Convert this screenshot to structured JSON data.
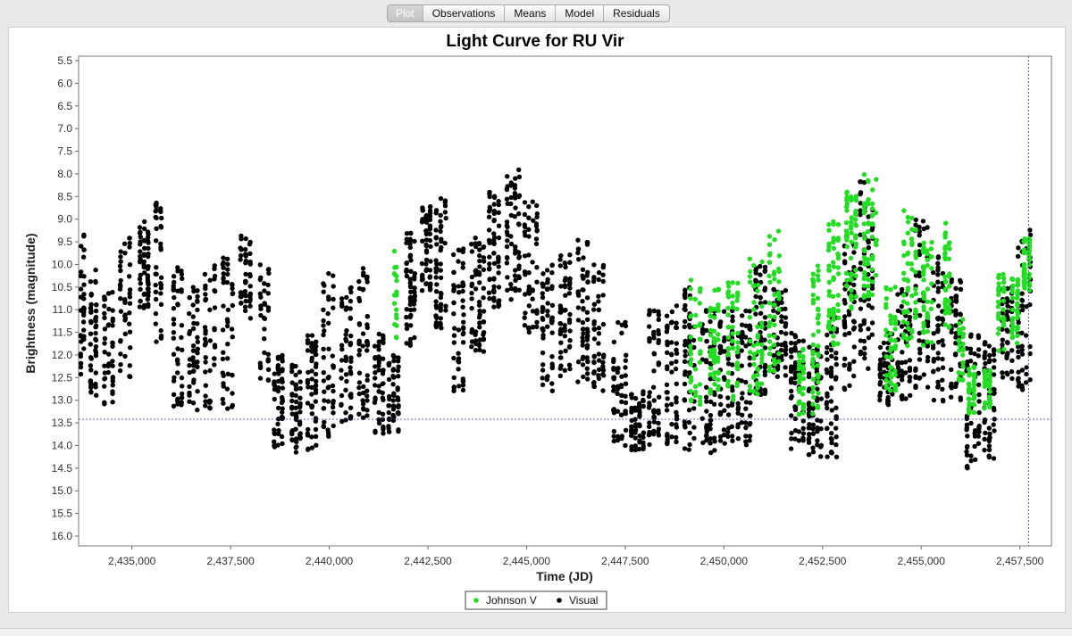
{
  "tabs": [
    {
      "label": "Plot",
      "active": true
    },
    {
      "label": "Observations",
      "active": false
    },
    {
      "label": "Means",
      "active": false
    },
    {
      "label": "Model",
      "active": false
    },
    {
      "label": "Residuals",
      "active": false
    }
  ],
  "colors": {
    "johnson_v": "#22dd22",
    "visual": "#000000",
    "crosshair": "#3333aa"
  },
  "chart_data": {
    "type": "scatter",
    "title": "Light Curve for RU Vir",
    "xlabel": "Time (JD)",
    "ylabel": "Brightness (magnitude)",
    "xlim": [
      2433650,
      2458300
    ],
    "ylim": [
      5.5,
      16.2
    ],
    "y_inverted": true,
    "xticks": [
      2435000,
      2437500,
      2440000,
      2442500,
      2445000,
      2447500,
      2450000,
      2452500,
      2455000,
      2457500
    ],
    "xtick_labels": [
      "2,435,000",
      "2,437,500",
      "2,440,000",
      "2,442,500",
      "2,445,000",
      "2,447,500",
      "2,450,000",
      "2,452,500",
      "2,455,000",
      "2,457,500"
    ],
    "yticks": [
      5.5,
      6.0,
      6.5,
      7.0,
      7.5,
      8.0,
      8.5,
      9.0,
      9.5,
      10.0,
      10.5,
      11.0,
      11.5,
      12.0,
      12.5,
      13.0,
      13.5,
      14.0,
      14.5,
      15.0,
      15.5,
      16.0
    ],
    "ytick_labels": [
      "5.5",
      "6.0",
      "6.5",
      "7.0",
      "7.5",
      "8.0",
      "8.5",
      "9.0",
      "9.5",
      "10.0",
      "10.5",
      "11.0",
      "11.5",
      "12.0",
      "12.5",
      "13.0",
      "13.5",
      "14.0",
      "14.5",
      "15.0",
      "15.5",
      "16.0"
    ],
    "crosshair": {
      "x": 2457720,
      "y": 13.42
    },
    "grid": false,
    "legend": {
      "placement": "bottom-center"
    },
    "series": [
      {
        "name": "Johnson V",
        "color": "#22dd22",
        "observing_windows": [
          {
            "x0": 2441650,
            "x1": 2441750,
            "ymin": 9.7,
            "ymax": 11.8,
            "n": 18
          },
          {
            "x0": 2449150,
            "x1": 2449500,
            "ymin": 10.3,
            "ymax": 13.1,
            "n": 40
          },
          {
            "x0": 2449650,
            "x1": 2449950,
            "ymin": 10.5,
            "ymax": 12.9,
            "n": 45
          },
          {
            "x0": 2450100,
            "x1": 2450450,
            "ymin": 10.4,
            "ymax": 13.0,
            "n": 45
          },
          {
            "x0": 2450650,
            "x1": 2451050,
            "ymin": 9.8,
            "ymax": 12.9,
            "n": 45
          },
          {
            "x0": 2451150,
            "x1": 2451500,
            "ymin": 9.2,
            "ymax": 12.4,
            "n": 45
          },
          {
            "x0": 2451900,
            "x1": 2452100,
            "ymin": 11.8,
            "ymax": 13.4,
            "n": 35
          },
          {
            "x0": 2452250,
            "x1": 2452500,
            "ymin": 10.0,
            "ymax": 13.3,
            "n": 45
          },
          {
            "x0": 2452650,
            "x1": 2453000,
            "ymin": 9.0,
            "ymax": 11.8,
            "n": 55
          },
          {
            "x0": 2453100,
            "x1": 2453450,
            "ymin": 8.3,
            "ymax": 11.0,
            "n": 60
          },
          {
            "x0": 2453550,
            "x1": 2453950,
            "ymin": 8.0,
            "ymax": 10.8,
            "n": 55
          },
          {
            "x0": 2454100,
            "x1": 2454450,
            "ymin": 10.5,
            "ymax": 12.8,
            "n": 50
          },
          {
            "x0": 2454550,
            "x1": 2454950,
            "ymin": 8.8,
            "ymax": 11.8,
            "n": 55
          },
          {
            "x0": 2455050,
            "x1": 2455350,
            "ymin": 9.5,
            "ymax": 11.9,
            "n": 45
          },
          {
            "x0": 2455600,
            "x1": 2455800,
            "ymin": 9.0,
            "ymax": 11.5,
            "n": 40
          },
          {
            "x0": 2455950,
            "x1": 2456150,
            "ymin": 11.2,
            "ymax": 12.6,
            "n": 30
          },
          {
            "x0": 2456200,
            "x1": 2456450,
            "ymin": 12.2,
            "ymax": 13.3,
            "n": 40
          },
          {
            "x0": 2456600,
            "x1": 2456850,
            "ymin": 12.3,
            "ymax": 13.2,
            "n": 30
          },
          {
            "x0": 2456950,
            "x1": 2457200,
            "ymin": 10.2,
            "ymax": 12.0,
            "n": 35
          },
          {
            "x0": 2457300,
            "x1": 2457550,
            "ymin": 10.3,
            "ymax": 11.8,
            "n": 40
          },
          {
            "x0": 2457600,
            "x1": 2457850,
            "ymin": 9.4,
            "ymax": 10.6,
            "n": 50
          }
        ]
      },
      {
        "name": "Visual",
        "color": "#000000",
        "observing_windows": [
          {
            "x0": 2433700,
            "x1": 2433850,
            "ymin": 9.3,
            "ymax": 12.7,
            "n": 35
          },
          {
            "x0": 2433950,
            "x1": 2434200,
            "ymin": 10.0,
            "ymax": 12.9,
            "n": 45
          },
          {
            "x0": 2434300,
            "x1": 2434600,
            "ymin": 10.5,
            "ymax": 13.1,
            "n": 45
          },
          {
            "x0": 2434700,
            "x1": 2435050,
            "ymin": 9.4,
            "ymax": 12.6,
            "n": 45
          },
          {
            "x0": 2435200,
            "x1": 2435500,
            "ymin": 8.9,
            "ymax": 11.0,
            "n": 60
          },
          {
            "x0": 2435600,
            "x1": 2435850,
            "ymin": 8.6,
            "ymax": 12.0,
            "n": 40
          },
          {
            "x0": 2436050,
            "x1": 2436350,
            "ymin": 10.0,
            "ymax": 13.2,
            "n": 45
          },
          {
            "x0": 2436450,
            "x1": 2436750,
            "ymin": 10.5,
            "ymax": 13.3,
            "n": 45
          },
          {
            "x0": 2436850,
            "x1": 2437200,
            "ymin": 10.0,
            "ymax": 13.3,
            "n": 45
          },
          {
            "x0": 2437300,
            "x1": 2437650,
            "ymin": 9.8,
            "ymax": 13.2,
            "n": 45
          },
          {
            "x0": 2437750,
            "x1": 2438100,
            "ymin": 9.3,
            "ymax": 11.2,
            "n": 45
          },
          {
            "x0": 2438250,
            "x1": 2438550,
            "ymin": 10.0,
            "ymax": 12.6,
            "n": 35
          },
          {
            "x0": 2438600,
            "x1": 2438900,
            "ymin": 12.0,
            "ymax": 14.1,
            "n": 50
          },
          {
            "x0": 2439050,
            "x1": 2439350,
            "ymin": 12.2,
            "ymax": 14.2,
            "n": 50
          },
          {
            "x0": 2439450,
            "x1": 2439750,
            "ymin": 11.5,
            "ymax": 14.1,
            "n": 50
          },
          {
            "x0": 2439850,
            "x1": 2440200,
            "ymin": 10.2,
            "ymax": 13.8,
            "n": 50
          },
          {
            "x0": 2440300,
            "x1": 2440650,
            "ymin": 10.5,
            "ymax": 13.5,
            "n": 50
          },
          {
            "x0": 2440750,
            "x1": 2441050,
            "ymin": 10.0,
            "ymax": 13.4,
            "n": 50
          },
          {
            "x0": 2441150,
            "x1": 2441450,
            "ymin": 11.5,
            "ymax": 13.8,
            "n": 50
          },
          {
            "x0": 2441500,
            "x1": 2441850,
            "ymin": 12.0,
            "ymax": 13.7,
            "n": 50
          },
          {
            "x0": 2441950,
            "x1": 2442250,
            "ymin": 9.3,
            "ymax": 11.8,
            "n": 55
          },
          {
            "x0": 2442350,
            "x1": 2442650,
            "ymin": 8.7,
            "ymax": 10.6,
            "n": 55
          },
          {
            "x0": 2442700,
            "x1": 2443050,
            "ymin": 8.4,
            "ymax": 11.5,
            "n": 55
          },
          {
            "x0": 2443150,
            "x1": 2443500,
            "ymin": 9.5,
            "ymax": 12.8,
            "n": 55
          },
          {
            "x0": 2443600,
            "x1": 2444000,
            "ymin": 9.4,
            "ymax": 12.0,
            "n": 60
          },
          {
            "x0": 2444050,
            "x1": 2444400,
            "ymin": 8.4,
            "ymax": 11.0,
            "n": 60
          },
          {
            "x0": 2444500,
            "x1": 2444900,
            "ymin": 7.9,
            "ymax": 10.8,
            "n": 60
          },
          {
            "x0": 2444950,
            "x1": 2445350,
            "ymin": 8.6,
            "ymax": 11.5,
            "n": 55
          },
          {
            "x0": 2445400,
            "x1": 2445750,
            "ymin": 10.0,
            "ymax": 12.8,
            "n": 55
          },
          {
            "x0": 2445850,
            "x1": 2446200,
            "ymin": 9.7,
            "ymax": 12.6,
            "n": 55
          },
          {
            "x0": 2446300,
            "x1": 2446650,
            "ymin": 9.3,
            "ymax": 12.6,
            "n": 55
          },
          {
            "x0": 2446700,
            "x1": 2447050,
            "ymin": 10.0,
            "ymax": 12.8,
            "n": 50
          },
          {
            "x0": 2447200,
            "x1": 2447600,
            "ymin": 11.2,
            "ymax": 14.0,
            "n": 55
          },
          {
            "x0": 2447650,
            "x1": 2448050,
            "ymin": 12.8,
            "ymax": 14.1,
            "n": 55
          },
          {
            "x0": 2448100,
            "x1": 2448450,
            "ymin": 11.0,
            "ymax": 14.0,
            "n": 55
          },
          {
            "x0": 2448550,
            "x1": 2448900,
            "ymin": 10.9,
            "ymax": 14.0,
            "n": 55
          },
          {
            "x0": 2449000,
            "x1": 2449350,
            "ymin": 10.5,
            "ymax": 14.1,
            "n": 55
          },
          {
            "x0": 2449450,
            "x1": 2449850,
            "ymin": 11.0,
            "ymax": 14.2,
            "n": 60
          },
          {
            "x0": 2449900,
            "x1": 2450300,
            "ymin": 11.0,
            "ymax": 14.0,
            "n": 60
          },
          {
            "x0": 2450350,
            "x1": 2450750,
            "ymin": 11.0,
            "ymax": 14.0,
            "n": 60
          },
          {
            "x0": 2450800,
            "x1": 2451150,
            "ymin": 10.0,
            "ymax": 12.9,
            "n": 55
          },
          {
            "x0": 2451250,
            "x1": 2451650,
            "ymin": 10.5,
            "ymax": 12.5,
            "n": 55
          },
          {
            "x0": 2451700,
            "x1": 2452100,
            "ymin": 11.5,
            "ymax": 14.1,
            "n": 60
          },
          {
            "x0": 2452150,
            "x1": 2452550,
            "ymin": 11.8,
            "ymax": 14.4,
            "n": 60
          },
          {
            "x0": 2452600,
            "x1": 2452950,
            "ymin": 11.0,
            "ymax": 14.3,
            "n": 55
          },
          {
            "x0": 2453050,
            "x1": 2453400,
            "ymin": 9.5,
            "ymax": 12.8,
            "n": 55
          },
          {
            "x0": 2453450,
            "x1": 2453850,
            "ymin": 7.9,
            "ymax": 12.3,
            "n": 60
          },
          {
            "x0": 2453950,
            "x1": 2454350,
            "ymin": 11.5,
            "ymax": 13.1,
            "n": 55
          },
          {
            "x0": 2454400,
            "x1": 2454800,
            "ymin": 10.5,
            "ymax": 13.0,
            "n": 55
          },
          {
            "x0": 2454850,
            "x1": 2455250,
            "ymin": 9.0,
            "ymax": 12.8,
            "n": 55
          },
          {
            "x0": 2455300,
            "x1": 2455650,
            "ymin": 9.8,
            "ymax": 13.1,
            "n": 50
          },
          {
            "x0": 2455750,
            "x1": 2456100,
            "ymin": 10.0,
            "ymax": 13.0,
            "n": 50
          },
          {
            "x0": 2456150,
            "x1": 2456550,
            "ymin": 11.5,
            "ymax": 14.5,
            "n": 55
          },
          {
            "x0": 2456600,
            "x1": 2456950,
            "ymin": 11.6,
            "ymax": 14.3,
            "n": 55
          },
          {
            "x0": 2457050,
            "x1": 2457400,
            "ymin": 10.5,
            "ymax": 12.6,
            "n": 45
          },
          {
            "x0": 2457450,
            "x1": 2457850,
            "ymin": 9.2,
            "ymax": 12.8,
            "n": 50
          }
        ]
      }
    ]
  }
}
